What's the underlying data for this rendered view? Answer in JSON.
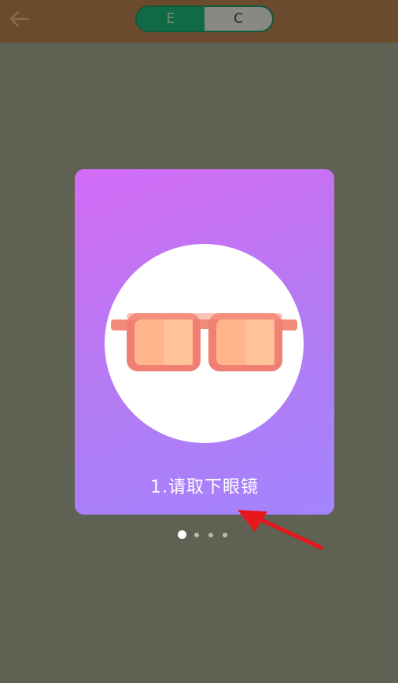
{
  "header": {
    "back_icon": "arrow-left-icon",
    "segments": [
      {
        "label": "E",
        "selected": true
      },
      {
        "label": "C",
        "selected": false
      }
    ]
  },
  "card": {
    "image_icon": "sunglasses-icon",
    "caption": "1.请取下眼镜"
  },
  "pager": {
    "total": 4,
    "active_index": 0
  },
  "colors": {
    "topbar": "#6b4a2e",
    "background": "#5f6152",
    "segment_selected": "#0f6a45",
    "segment_unselected": "#888983",
    "card_gradient_start": "#d36cf6",
    "card_gradient_end": "#a484ff",
    "annotation_arrow": "#e8171b"
  }
}
